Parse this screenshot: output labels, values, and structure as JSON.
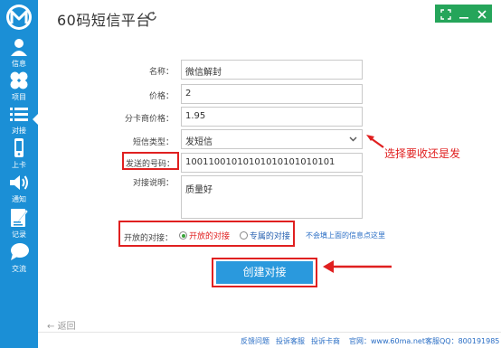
{
  "app": {
    "title": "60码短信平台"
  },
  "sidebar": {
    "items": [
      {
        "label": "信息"
      },
      {
        "label": "项目"
      },
      {
        "label": "对接"
      },
      {
        "label": "上卡"
      },
      {
        "label": "通知"
      },
      {
        "label": "记录"
      },
      {
        "label": "交流"
      }
    ]
  },
  "form": {
    "name": {
      "label": "名称：",
      "value": "微信解封"
    },
    "price": {
      "label": "价格：",
      "value": "2"
    },
    "card_price": {
      "label": "分卡商价格：",
      "value": "1.95"
    },
    "sms_type": {
      "label": "短信类型：",
      "value": "发短信"
    },
    "send_number": {
      "label": "发送的号码：",
      "value": "10011001010101010101010101"
    },
    "desc": {
      "label": "对接说明：",
      "value": "质量好"
    },
    "mode": {
      "label": "开放的对接：",
      "open_label": "开放的对接",
      "private_label": "专属的对接",
      "selected": "open"
    },
    "hint": "不会填上面的信息点这里",
    "submit": "创建对接"
  },
  "annotation": {
    "text": "选择要收还是发"
  },
  "back": "返回",
  "footer": {
    "links": [
      "反馈问题",
      "投诉客服",
      "投诉卡商"
    ],
    "site": "官网：www.60ma.net",
    "qq": "客服QQ：800191985"
  },
  "colors": {
    "sidebar": "#1b8fd6",
    "accent": "#2a99dd",
    "annotation": "#e02020",
    "window_controls": "#25a55a"
  }
}
